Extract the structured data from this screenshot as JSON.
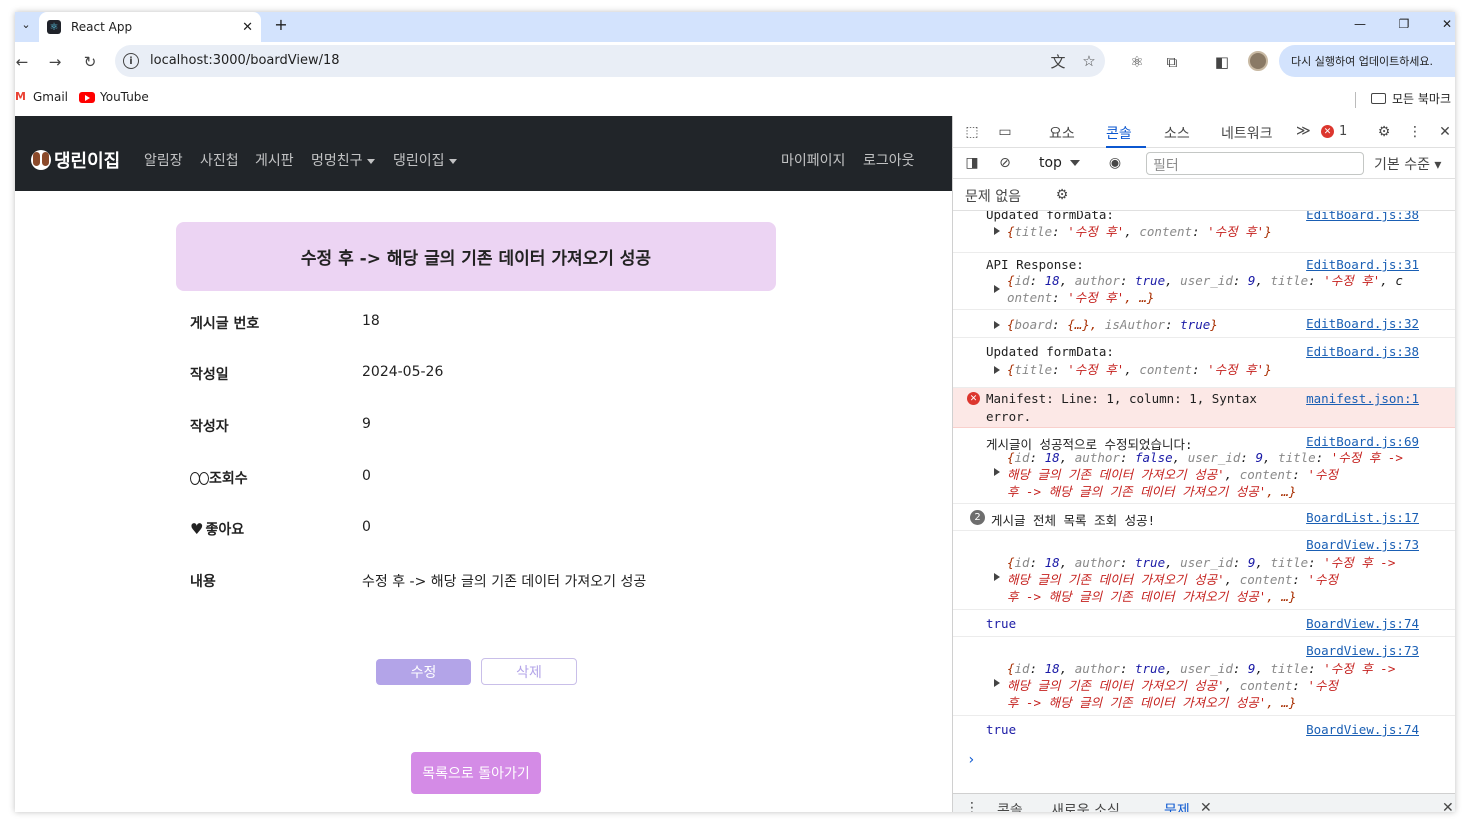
{
  "browser": {
    "tab_title": "React App",
    "tab_close": "✕",
    "new_tab": "+",
    "url": "localhost:3000/boardView/18",
    "update_button": "다시 실행하여 업데이트하세요.",
    "bookmarks": [
      "Gmail",
      "YouTube"
    ],
    "all_bookmarks": "모든 북마크"
  },
  "navbar": {
    "brand": "댕린이집",
    "items": [
      "알림장",
      "사진첩",
      "게시판",
      "멍멍친구",
      "댕린이집"
    ],
    "right_items": [
      "마이페이지",
      "로그아웃"
    ]
  },
  "board": {
    "banner": "수정 후 -> 해당 글의 기존 데이터 가져오기 성공",
    "rows": [
      {
        "label": "게시글 번호",
        "value": "18"
      },
      {
        "label": "작성일",
        "value": "2024-05-26"
      },
      {
        "label": "작성자",
        "value": "9"
      },
      {
        "label": "조회수",
        "value": "0"
      },
      {
        "label": "좋아요",
        "value": "0"
      },
      {
        "label": "내용",
        "value": "수정 후 -> 해당 글의 기존 데이터 가져오기 성공"
      }
    ],
    "edit_button": "수정",
    "delete_button": "삭제",
    "back_button": "목록으로 돌아가기"
  },
  "devtools": {
    "tabs": [
      "요소",
      "콘솔",
      "소스",
      "네트워크"
    ],
    "active_tab": "콘솔",
    "more_tabs": "≫",
    "error_count": "1",
    "context": "top",
    "filter_placeholder": "필터",
    "level": "기본 수준",
    "issues": "문제 없음",
    "messages": {
      "m1_text": "Updated formData:",
      "m1_link": "EditBoard.js:38",
      "m2_text": "API Response:",
      "m2_link": "EditBoard.js:31",
      "m3_link": "EditBoard.js:32",
      "m4_text": "Updated formData:",
      "m4_link": "EditBoard.js:38",
      "err_line1": "Manifest: Line: 1, column: 1, Syntax",
      "err_line2": "error.",
      "err_link": "manifest.json:1",
      "m6_text": "게시글이 성공적으로 수정되었습니다:",
      "m6_link": "EditBoard.js:69",
      "m7_count": "2",
      "m7_text": "게시글 전체 목록 조회 성공!",
      "m7_link": "BoardList.js:17",
      "m8_link": "BoardView.js:73",
      "m9_text": "true",
      "m9_link": "BoardView.js:74",
      "m10_link": "BoardView.js:73",
      "m11_text": "true",
      "m11_link": "BoardView.js:74"
    },
    "drawer_tabs": [
      "콘솔",
      "새로운 소식",
      "문제"
    ]
  }
}
